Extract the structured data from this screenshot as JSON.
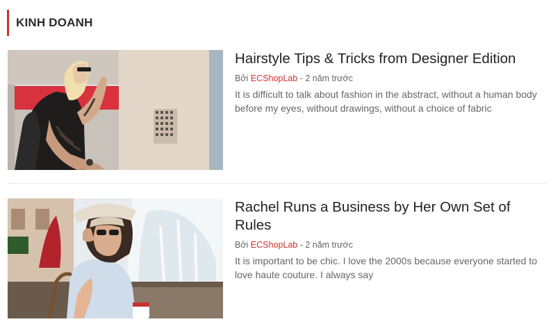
{
  "section": {
    "title": "KINH DOANH",
    "accent": "#d0302b"
  },
  "articles": [
    {
      "title": "Hairstyle Tips & Tricks from Designer Edition",
      "by_label": "Bởi",
      "author": "ECShopLab",
      "separator": " - ",
      "date": "2 năm trước",
      "excerpt": "It is difficult to talk about fashion in the abstract, without a human body before my eyes, without drawings, without a choice of fabric"
    },
    {
      "title": "Rachel Runs a Business by Her Own Set of Rules",
      "by_label": "Bởi",
      "author": "ECShopLab",
      "separator": " - ",
      "date": "2 năm trước",
      "excerpt": "It is important to be chic. I love the 2000s because everyone started to love haute couture. I always say"
    }
  ]
}
